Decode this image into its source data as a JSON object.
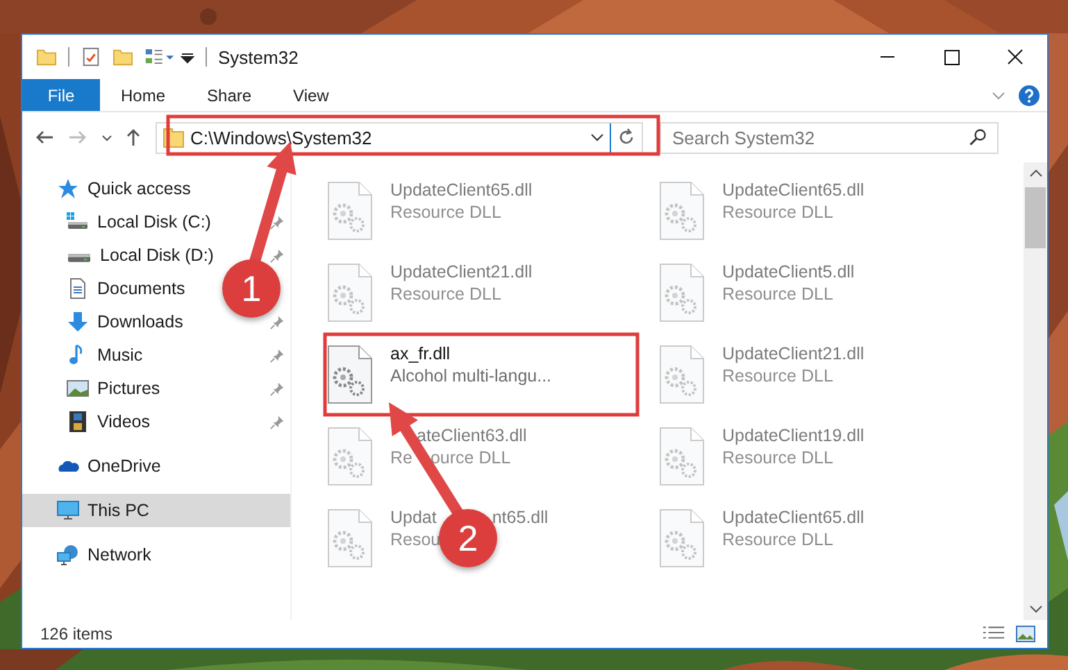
{
  "window": {
    "title": "System32"
  },
  "ribbon": {
    "file_button": "File",
    "tabs": [
      {
        "label": "Home",
        "selected": false
      },
      {
        "label": "Share",
        "selected": false
      },
      {
        "label": "View",
        "selected": false
      }
    ]
  },
  "address_bar": {
    "path": "C:\\Windows\\System32"
  },
  "search": {
    "placeholder": "Search System32"
  },
  "sidebar": {
    "items": [
      {
        "label": "Quick access",
        "selected": false,
        "children": [
          {
            "label": "Local Disk (C:)",
            "pinned": true,
            "selected": false
          },
          {
            "label": "Local Disk (D:)",
            "pinned": true,
            "selected": false
          },
          {
            "label": "Documents",
            "pinned": false,
            "selected": false
          },
          {
            "label": "Downloads",
            "pinned": true,
            "selected": false
          },
          {
            "label": "Music",
            "pinned": true,
            "selected": false
          },
          {
            "label": "Pictures",
            "pinned": true,
            "selected": false
          },
          {
            "label": "Videos",
            "pinned": true,
            "selected": false
          }
        ]
      },
      {
        "label": "OneDrive",
        "selected": false
      },
      {
        "label": "This PC",
        "selected": true
      },
      {
        "label": "Network",
        "selected": false
      }
    ]
  },
  "files": [
    {
      "name_parts": [
        "UpdateClient65.dll"
      ],
      "description_parts": [
        "Resource DLL"
      ],
      "blurred": true
    },
    {
      "name_parts": [
        "UpdateClient65.dll"
      ],
      "description_parts": [
        "Resource DLL"
      ],
      "blurred": true
    },
    {
      "name_parts": [
        "UpdateClient21.dll"
      ],
      "description_parts": [
        "Resource DLL"
      ],
      "blurred": true
    },
    {
      "name_parts": [
        "UpdateClient5.dll"
      ],
      "description_parts": [
        "Resource DLL"
      ],
      "blurred": true
    },
    {
      "name_parts": [
        "ax_fr.dll"
      ],
      "description_parts": [
        "Alcohol multi-langu..."
      ],
      "blurred": false
    },
    {
      "name_parts": [
        "UpdateClient21.dll"
      ],
      "description_parts": [
        "Resource DLL"
      ],
      "blurred": true
    },
    {
      "name_parts": [
        "ateClient63.dll"
      ],
      "description_parts": [
        "Re",
        "ource DLL"
      ],
      "blurred": true
    },
    {
      "name_parts": [
        "UpdateClient19.dll"
      ],
      "description_parts": [
        "Resource DLL"
      ],
      "blurred": true
    },
    {
      "name_parts": [
        "Updat",
        "nt65.dll"
      ],
      "description_parts": [
        "Resou"
      ],
      "blurred": true
    },
    {
      "name_parts": [
        "UpdateClient65.dll"
      ],
      "description_parts": [
        "Resource DLL"
      ],
      "blurred": true
    }
  ],
  "status_bar": {
    "item_count": "126 items"
  },
  "annotations": [
    {
      "number": "1"
    },
    {
      "number": "2"
    }
  ]
}
